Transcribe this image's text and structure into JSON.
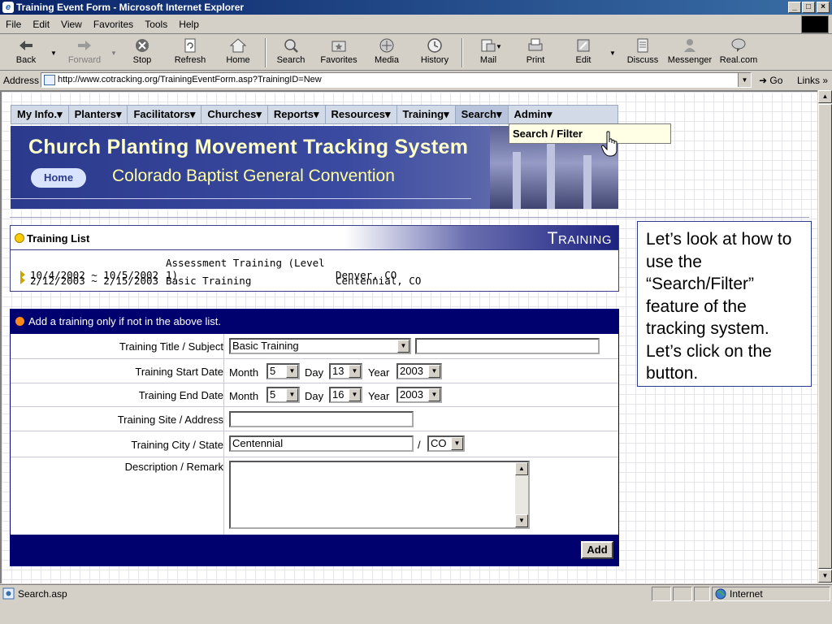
{
  "window": {
    "title": "Training Event Form - Microsoft Internet Explorer",
    "controls": [
      "_",
      "□",
      "×"
    ]
  },
  "menubar": [
    "File",
    "Edit",
    "View",
    "Favorites",
    "Tools",
    "Help"
  ],
  "toolbar": {
    "back": "Back",
    "forward": "Forward",
    "stop": "Stop",
    "refresh": "Refresh",
    "home": "Home",
    "search": "Search",
    "favorites": "Favorites",
    "media": "Media",
    "history": "History",
    "mail": "Mail",
    "print": "Print",
    "edit": "Edit",
    "discuss": "Discuss",
    "messenger": "Messenger",
    "realcom": "Real.com"
  },
  "address": {
    "label": "Address",
    "url": "http://www.cotracking.org/TrainingEventForm.asp?TrainingID=New",
    "go": "Go",
    "links": "Links"
  },
  "nav": {
    "items": [
      "My Info.",
      "Planters",
      "Facilitators",
      "Churches",
      "Reports",
      "Resources",
      "Training",
      "Search",
      "Admin"
    ],
    "dropdown_item": "Search / Filter"
  },
  "banner": {
    "title": "Church Planting Movement Tracking System",
    "subtitle": "Colorado Baptist General Convention",
    "home": "Home"
  },
  "training_list": {
    "title": "Training List",
    "banner_word": "Training",
    "rows": [
      {
        "dates": "10/4/2002 ~ 10/5/2002",
        "name": "Assessment Training (Level 1)",
        "place": "Denver, CO"
      },
      {
        "dates": "2/12/2003 ~ 2/15/2003",
        "name": "Basic Training",
        "place": "Centennial, CO"
      }
    ]
  },
  "note": "Let’s look at how to use the “Search/Filter” feature of the tracking system. Let’s click on the button.",
  "form": {
    "header": "Add a training only if not in the above list.",
    "labels": {
      "title": "Training Title / Subject",
      "start": "Training Start Date",
      "end": "Training End Date",
      "site": "Training Site / Address",
      "city": "Training City / State",
      "desc": "Description / Remark"
    },
    "title_select": "Basic Training",
    "title_other": "",
    "month_label": "Month",
    "day_label": "Day",
    "year_label": "Year",
    "start": {
      "month": "5",
      "day": "13",
      "year": "2003"
    },
    "end": {
      "month": "5",
      "day": "16",
      "year": "2003"
    },
    "site": "",
    "city": "Centennial",
    "slash": "/",
    "state": "CO",
    "description": "",
    "add_button": "Add"
  },
  "status": {
    "text": "Search.asp",
    "zone": "Internet"
  }
}
